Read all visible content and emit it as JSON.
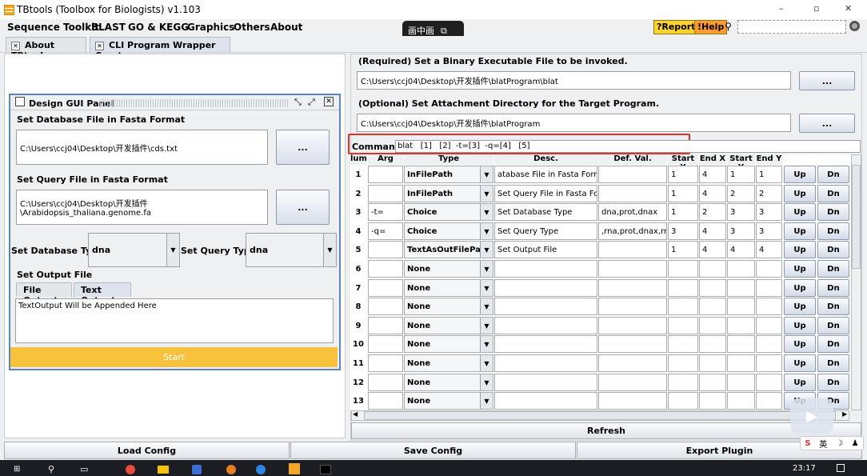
{
  "window": {
    "title": "TBtools (Toolbox for Biologists) v1.103",
    "controls": [
      "–",
      "▫",
      "✕"
    ]
  },
  "menu": [
    "Sequence Toolkit",
    "BLAST",
    "GO & KEGG",
    "Graphics",
    "Others",
    "About"
  ],
  "toolbar": {
    "report": "?Report",
    "help": "!Help"
  },
  "pip_label": "画中画",
  "tabs": [
    {
      "label": "About TBtools"
    },
    {
      "label": "CLI Program Wrapper Creator"
    }
  ],
  "gui_panel": {
    "title": "Design GUI Panel",
    "db_section": "Set Database File in Fasta Format",
    "db_value": "C:\\Users\\ccj04\\Desktop\\开发插件\\cds.txt",
    "query_section": "Set Query File in Fasta Format",
    "query_value": "C:\\Users\\ccj04\\Desktop\\开发插件\\Arabidopsis_thaliana.genome.fa",
    "browse": "...",
    "db_type_label": "Set Database Type:",
    "db_type_value": "dna",
    "query_type_label": "Set Query Type:",
    "query_type_value": "dna",
    "output_section": "Set Output File",
    "output_tabs": [
      "File Output",
      "Text Output"
    ],
    "output_text": "TextOutput Will be Appended Here",
    "start": "Start"
  },
  "right": {
    "binary_label": "(Required) Set a Binary Executable File to be invoked.",
    "binary_value": "C:\\Users\\ccj04\\Desktop\\开发插件\\blatProgram\\blat",
    "attach_label": "(Optional) Set Attachment Directory for the Target Program.",
    "attach_value": "C:\\Users\\ccj04\\Desktop\\开发插件\\blatProgram",
    "browse": "...",
    "command_label": "Command:",
    "command_value": "blat   [1]   [2]  -t=[3]  -q=[4]   [5]",
    "refresh": "Refresh"
  },
  "table": {
    "headers": [
      "lum.",
      "Arg",
      "Type",
      "Desc.",
      "Def. Val.",
      "Start X",
      "End X",
      "Start Y",
      "End Y"
    ],
    "up": "Up",
    "dn": "Dn",
    "rows": [
      {
        "num": "1",
        "arg": "",
        "type": "InFilePath",
        "desc": "atabase File in Fasta Format",
        "def": "",
        "sx": "1",
        "ex": "4",
        "sy": "1",
        "ey": "1"
      },
      {
        "num": "2",
        "arg": "",
        "type": "InFilePath",
        "desc": "Set Query File in Fasta Form",
        "def": "",
        "sx": "1",
        "ex": "4",
        "sy": "2",
        "ey": "2"
      },
      {
        "num": "3",
        "arg": "-t=",
        "type": "Choice",
        "desc": "Set Database Type",
        "def": "dna,prot,dnax",
        "sx": "1",
        "ex": "2",
        "sy": "3",
        "ey": "3"
      },
      {
        "num": "4",
        "arg": "-q=",
        "type": "Choice",
        "desc": "Set Query Type",
        "def": ",rna,prot,dnax,rnax",
        "sx": "3",
        "ex": "4",
        "sy": "3",
        "ey": "3"
      },
      {
        "num": "5",
        "arg": "",
        "type": "TextAsOutFilePath",
        "desc": "Set Output File",
        "def": "",
        "sx": "1",
        "ex": "4",
        "sy": "4",
        "ey": "4"
      },
      {
        "num": "6",
        "arg": "",
        "type": "None",
        "desc": "",
        "def": "",
        "sx": "",
        "ex": "",
        "sy": "",
        "ey": ""
      },
      {
        "num": "7",
        "arg": "",
        "type": "None",
        "desc": "",
        "def": "",
        "sx": "",
        "ex": "",
        "sy": "",
        "ey": ""
      },
      {
        "num": "8",
        "arg": "",
        "type": "None",
        "desc": "",
        "def": "",
        "sx": "",
        "ex": "",
        "sy": "",
        "ey": ""
      },
      {
        "num": "9",
        "arg": "",
        "type": "None",
        "desc": "",
        "def": "",
        "sx": "",
        "ex": "",
        "sy": "",
        "ey": ""
      },
      {
        "num": "10",
        "arg": "",
        "type": "None",
        "desc": "",
        "def": "",
        "sx": "",
        "ex": "",
        "sy": "",
        "ey": ""
      },
      {
        "num": "11",
        "arg": "",
        "type": "None",
        "desc": "",
        "def": "",
        "sx": "",
        "ex": "",
        "sy": "",
        "ey": ""
      },
      {
        "num": "12",
        "arg": "",
        "type": "None",
        "desc": "",
        "def": "",
        "sx": "",
        "ex": "",
        "sy": "",
        "ey": ""
      },
      {
        "num": "13",
        "arg": "",
        "type": "None",
        "desc": "",
        "def": "",
        "sx": "",
        "ex": "",
        "sy": "",
        "ey": ""
      }
    ]
  },
  "bottom": {
    "load": "Load Config",
    "save": "Save Config",
    "export": "Export Plugin"
  },
  "taskbar": {
    "time": "23:17",
    "ime": "英"
  },
  "colors": {
    "accent": "#f9c23c",
    "highlight": "#e0302a",
    "panel_border": "#5b84c4",
    "report_bg": "#ffd22e",
    "help_bg": "#ff9a2e"
  }
}
